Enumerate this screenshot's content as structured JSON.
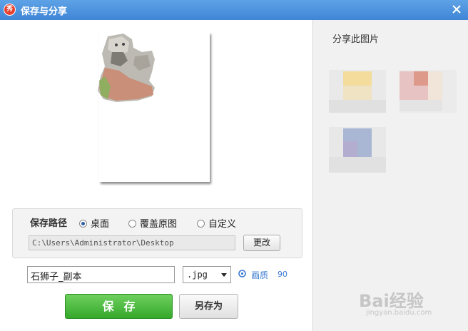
{
  "window": {
    "title": "保存与分享",
    "app_icon_text": "秀",
    "close_icon": "close-icon"
  },
  "share": {
    "title": "分享此图片",
    "tiles": [
      "share-target-1",
      "share-target-2",
      "share-target-3"
    ]
  },
  "preview": {
    "image": "stone-lion-statue"
  },
  "save_path": {
    "label": "保存路径",
    "options": [
      {
        "label": "桌面",
        "selected": true
      },
      {
        "label": "覆盖原图",
        "selected": false
      },
      {
        "label": "自定义",
        "selected": false
      }
    ],
    "path_value": "C:\\Users\\Administrator\\Desktop",
    "change_button": "更改"
  },
  "file": {
    "name": "石狮子_副本",
    "format": ".jpg",
    "quality_label": "画质",
    "quality_value": "90"
  },
  "buttons": {
    "save": "保存",
    "save_as": "另存为"
  },
  "watermark": {
    "brand": "Bai经验",
    "url": "jingyan.baidu.com"
  },
  "colors": {
    "titlebar": "#4a90dc",
    "save_button": "#3fb332",
    "link": "#3a7bd0"
  }
}
